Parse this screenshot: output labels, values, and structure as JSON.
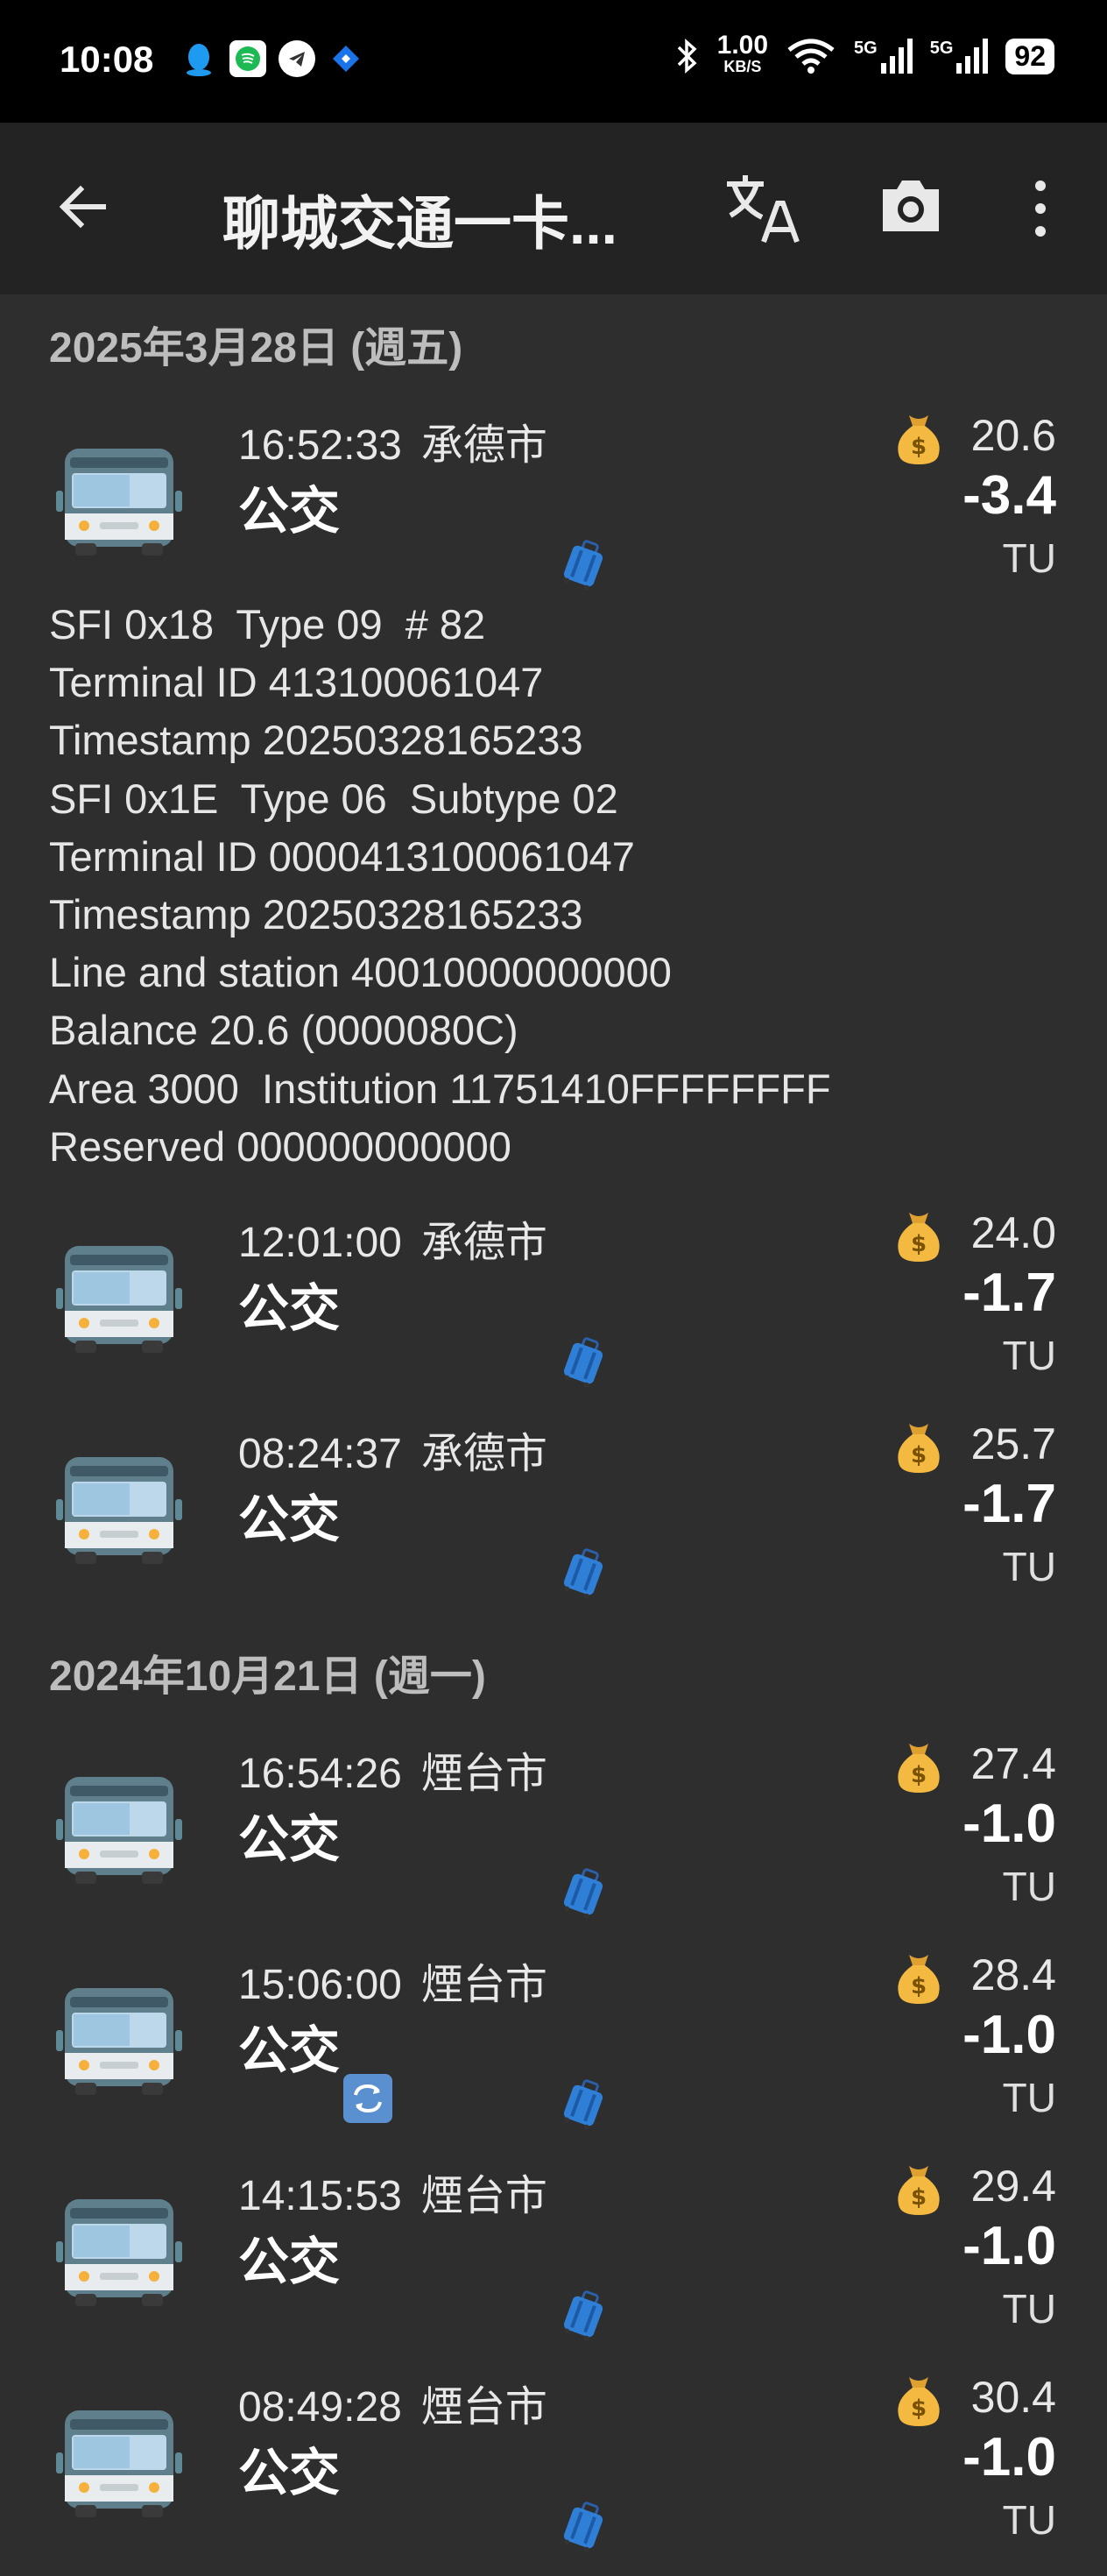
{
  "status_bar": {
    "time": "10:08",
    "net_speed": "1.00",
    "net_unit": "KB/S",
    "signal1": "5G",
    "signal2": "5G",
    "battery": "92"
  },
  "app_bar": {
    "title": "聊城交通一卡...",
    "icons": [
      "back-arrow-icon",
      "translate-icon",
      "camera-icon",
      "more-vert-icon"
    ]
  },
  "groups": [
    {
      "date": "2025年3月28日 (週五)",
      "items": [
        {
          "time": "16:52:33",
          "city": "承德市",
          "type": "公交",
          "balance": "20.6",
          "amount": "-3.4",
          "unit": "TU",
          "transfer": false,
          "details": [
            "SFI 0x18  Type 09  # 82",
            "Terminal ID 413100061047",
            "Timestamp 20250328165233",
            "SFI 0x1E  Type 06  Subtype 02",
            "Terminal ID 0000413100061047",
            "Timestamp 20250328165233",
            "Line and station 40010000000000",
            "Balance 20.6 (0000080C)",
            "Area 3000  Institution 11751410FFFFFFFF",
            "Reserved 000000000000"
          ]
        },
        {
          "time": "12:01:00",
          "city": "承德市",
          "type": "公交",
          "balance": "24.0",
          "amount": "-1.7",
          "unit": "TU",
          "transfer": false
        },
        {
          "time": "08:24:37",
          "city": "承德市",
          "type": "公交",
          "balance": "25.7",
          "amount": "-1.7",
          "unit": "TU",
          "transfer": false
        }
      ]
    },
    {
      "date": "2024年10月21日 (週一)",
      "items": [
        {
          "time": "16:54:26",
          "city": "煙台市",
          "type": "公交",
          "balance": "27.4",
          "amount": "-1.0",
          "unit": "TU",
          "transfer": false
        },
        {
          "time": "15:06:00",
          "city": "煙台市",
          "type": "公交",
          "balance": "28.4",
          "amount": "-1.0",
          "unit": "TU",
          "transfer": true
        },
        {
          "time": "14:15:53",
          "city": "煙台市",
          "type": "公交",
          "balance": "29.4",
          "amount": "-1.0",
          "unit": "TU",
          "transfer": false
        },
        {
          "time": "08:49:28",
          "city": "煙台市",
          "type": "公交",
          "balance": "30.4",
          "amount": "-1.0",
          "unit": "TU",
          "transfer": false
        }
      ]
    }
  ],
  "colors": {
    "background": "#2e2e2e",
    "app_bar": "#232323",
    "status_bar": "#000000"
  }
}
